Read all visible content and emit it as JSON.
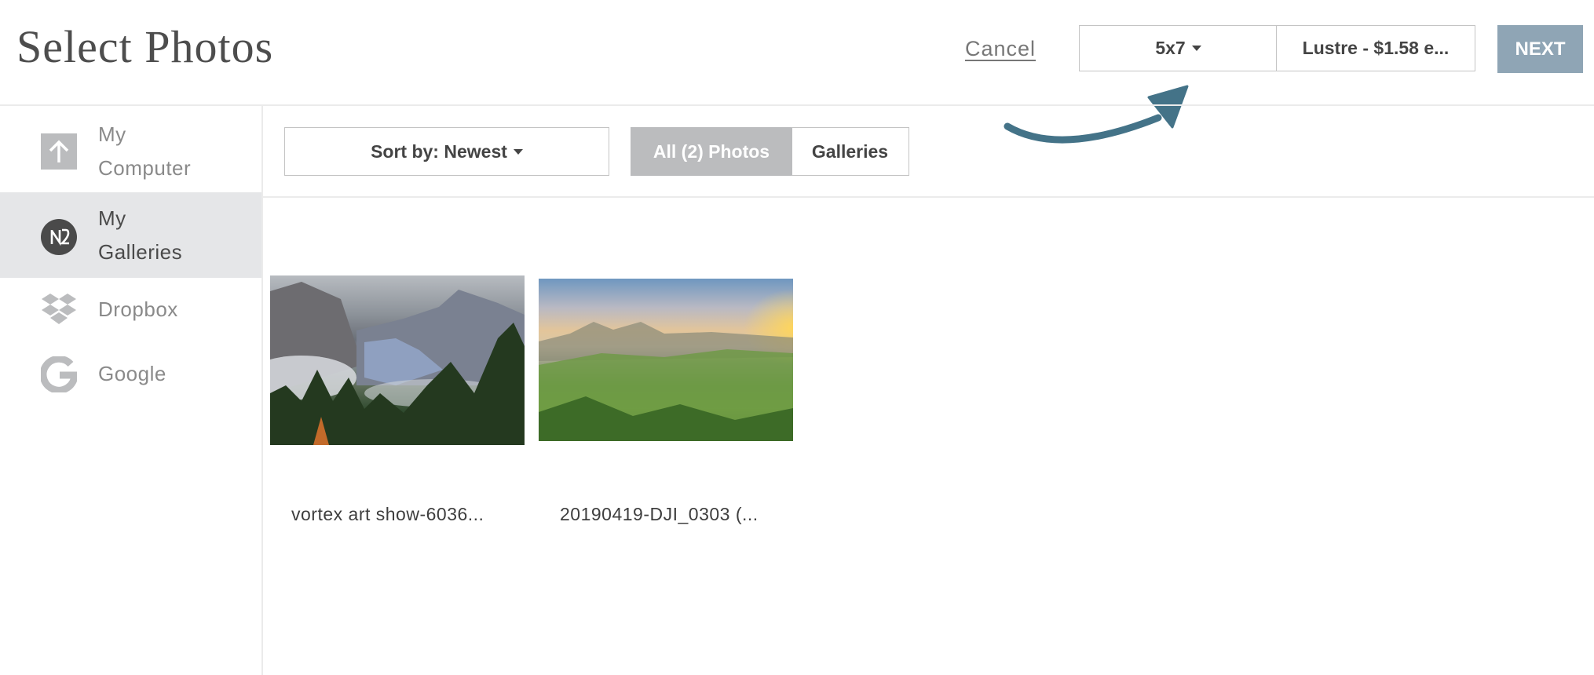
{
  "header": {
    "title": "Select Photos",
    "cancel_label": "Cancel",
    "size_select": {
      "value": "5x7"
    },
    "paper_select": {
      "value": "Lustre - $1.58 e..."
    },
    "next_label": "NEXT",
    "next_color": "#8fa5b5",
    "arrow_color": "#447388"
  },
  "sidebar": {
    "items": [
      {
        "label_line1": "My",
        "label_line2": "Computer",
        "icon": "upload-icon",
        "active": false
      },
      {
        "label_line1": "My",
        "label_line2": "Galleries",
        "icon": "galleries-logo-icon",
        "active": true
      },
      {
        "label": "Dropbox",
        "icon": "dropbox-icon",
        "active": false
      },
      {
        "label": "Google",
        "icon": "google-icon",
        "active": false
      }
    ]
  },
  "toolbar": {
    "sort_label": "Sort by: Newest",
    "tabs": [
      {
        "label": "All (2) Photos",
        "active": true
      },
      {
        "label": "Galleries",
        "active": false
      }
    ]
  },
  "photos": [
    {
      "caption": "vortex art show-6036...",
      "subject": "mountain valley with clouds and pines"
    },
    {
      "caption": "20190419-DJI_0303 (...",
      "subject": "green hills at sunrise above fog"
    }
  ]
}
